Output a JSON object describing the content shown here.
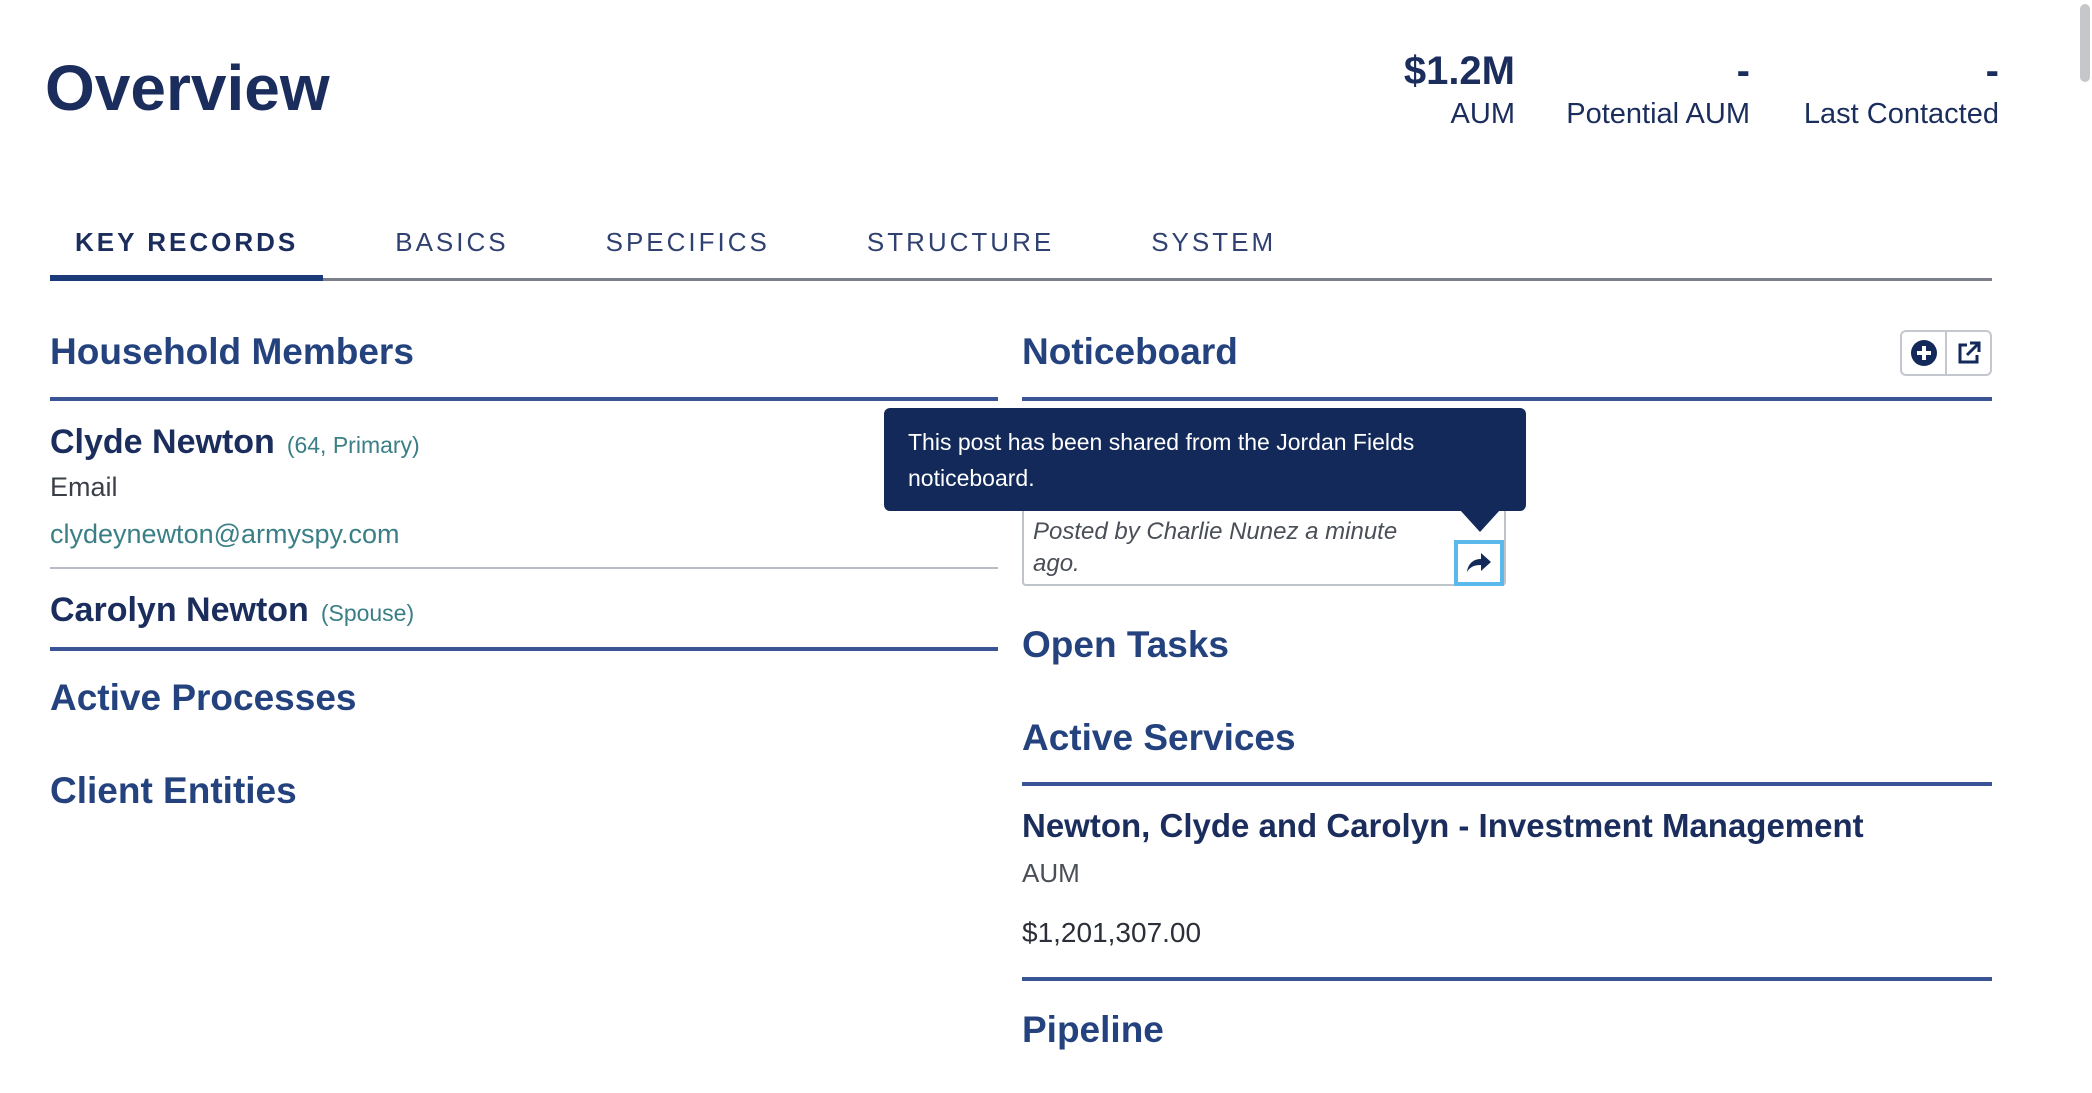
{
  "header": {
    "title": "Overview",
    "stats": [
      {
        "value": "$1.2M",
        "label": "AUM"
      },
      {
        "value": "-",
        "label": "Potential AUM"
      },
      {
        "value": "-",
        "label": "Last Contacted"
      }
    ]
  },
  "tabs": [
    {
      "label": "KEY RECORDS",
      "active": true
    },
    {
      "label": "BASICS"
    },
    {
      "label": "SPECIFICS"
    },
    {
      "label": "STRUCTURE"
    },
    {
      "label": "SYSTEM"
    }
  ],
  "household": {
    "title": "Household Members",
    "members": [
      {
        "name": "Clyde Newton",
        "meta": "(64, Primary)",
        "email_label": "Email",
        "email": "clydeynewton@armyspy.com"
      },
      {
        "name": "Carolyn Newton",
        "meta": "(Spouse)"
      }
    ]
  },
  "active_processes": {
    "title": "Active Processes"
  },
  "client_entities": {
    "title": "Client Entities"
  },
  "noticeboard": {
    "title": "Noticeboard",
    "post_meta": "Posted by Charlie Nunez a minute ago.",
    "tooltip": "This post has been shared from the Jordan Fields noticeboard.",
    "icons": {
      "add": "plus-circle-icon",
      "open": "external-link-icon",
      "share": "share-arrow-icon"
    }
  },
  "open_tasks": {
    "title": "Open Tasks"
  },
  "active_services": {
    "title": "Active Services",
    "items": [
      {
        "name": "Newton, Clyde and Carolyn - Investment Management",
        "label": "AUM",
        "value": "$1,201,307.00"
      }
    ]
  },
  "pipeline": {
    "title": "Pipeline"
  },
  "colors": {
    "primary": "#1a2d5c",
    "accent": "#3a5596",
    "link": "#3a7f86",
    "tooltip_bg": "#13295a",
    "focus": "#5ab8ea"
  }
}
